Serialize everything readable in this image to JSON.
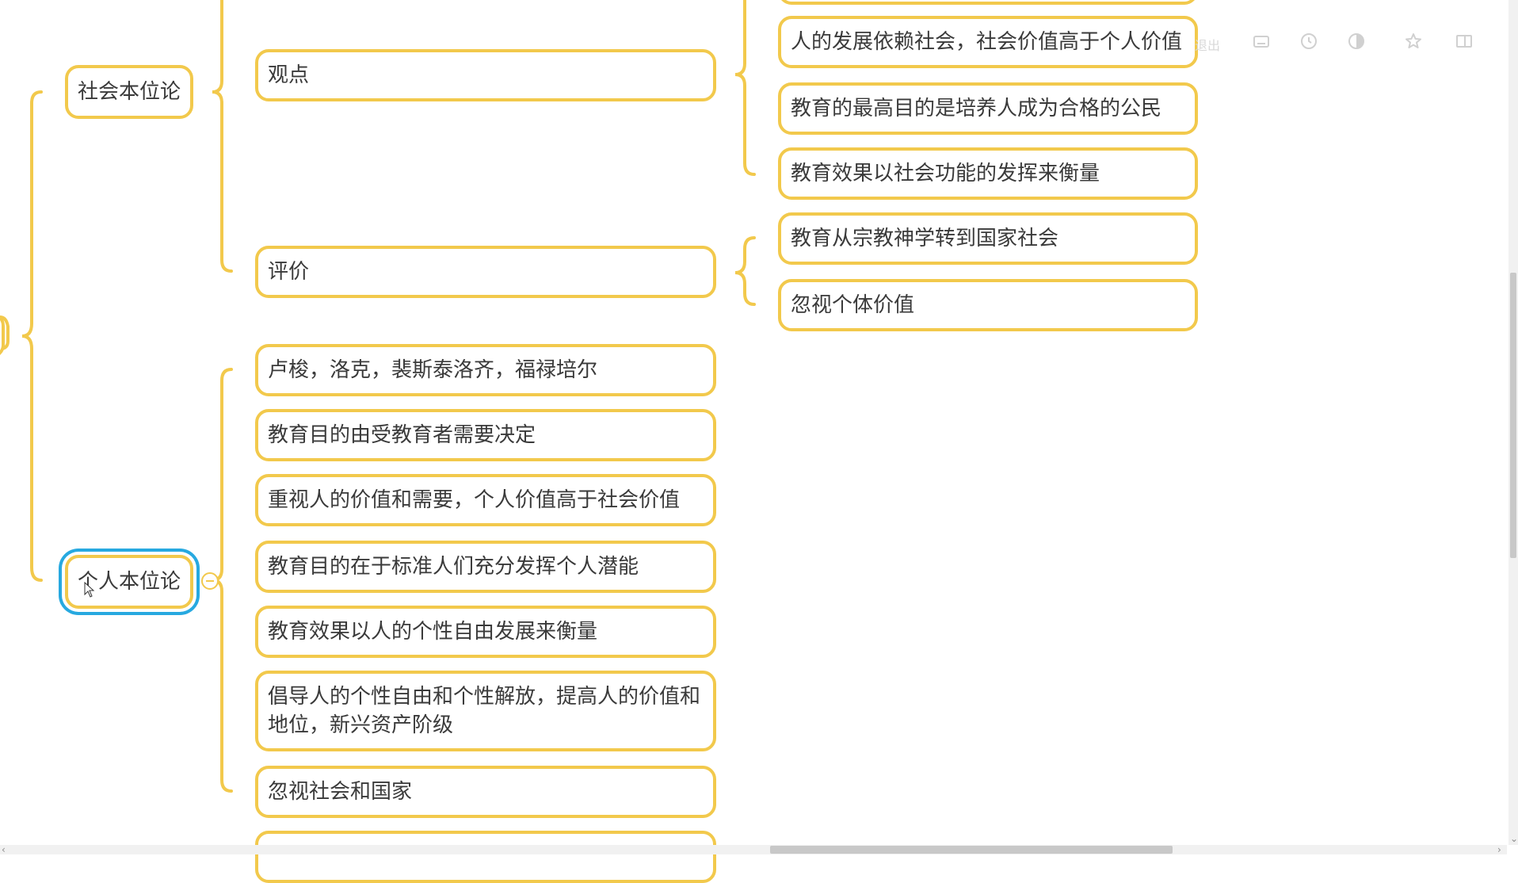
{
  "mindmap": {
    "social_branch": {
      "label": "社会本位论",
      "viewpoint": {
        "label": "观点",
        "items": [
          "人的发展依赖社会，社会价值高于个人价值",
          "教育的最高目的是培养人成为合格的公民",
          "教育效果以社会功能的发挥来衡量"
        ]
      },
      "evaluation": {
        "label": "评价",
        "items": [
          "教育从宗教神学转到国家社会",
          "忽视个体价值"
        ]
      }
    },
    "individual_branch": {
      "label": "个人本位论",
      "items": [
        "卢梭，洛克，裴斯泰洛齐，福禄培尔",
        "教育目的由受教育者需要决定",
        "重视人的价值和需要，个人价值高于社会价值",
        "教育目的在于标准人们充分发挥个人潜能",
        "教育效果以人的个性自由发展来衡量",
        "倡导人的个性自由和个性解放，提高人的价值和地位，新兴资产阶级",
        "忽视社会和国家"
      ]
    }
  },
  "toolbar": {
    "exit_label": "退出",
    "icons": [
      "keyboard-icon",
      "clock-icon",
      "contrast-icon",
      "star-icon",
      "split-view-icon"
    ]
  },
  "colors": {
    "branch": "#f2c94c",
    "selection": "#27a9e0",
    "text": "#3a3a3a"
  }
}
